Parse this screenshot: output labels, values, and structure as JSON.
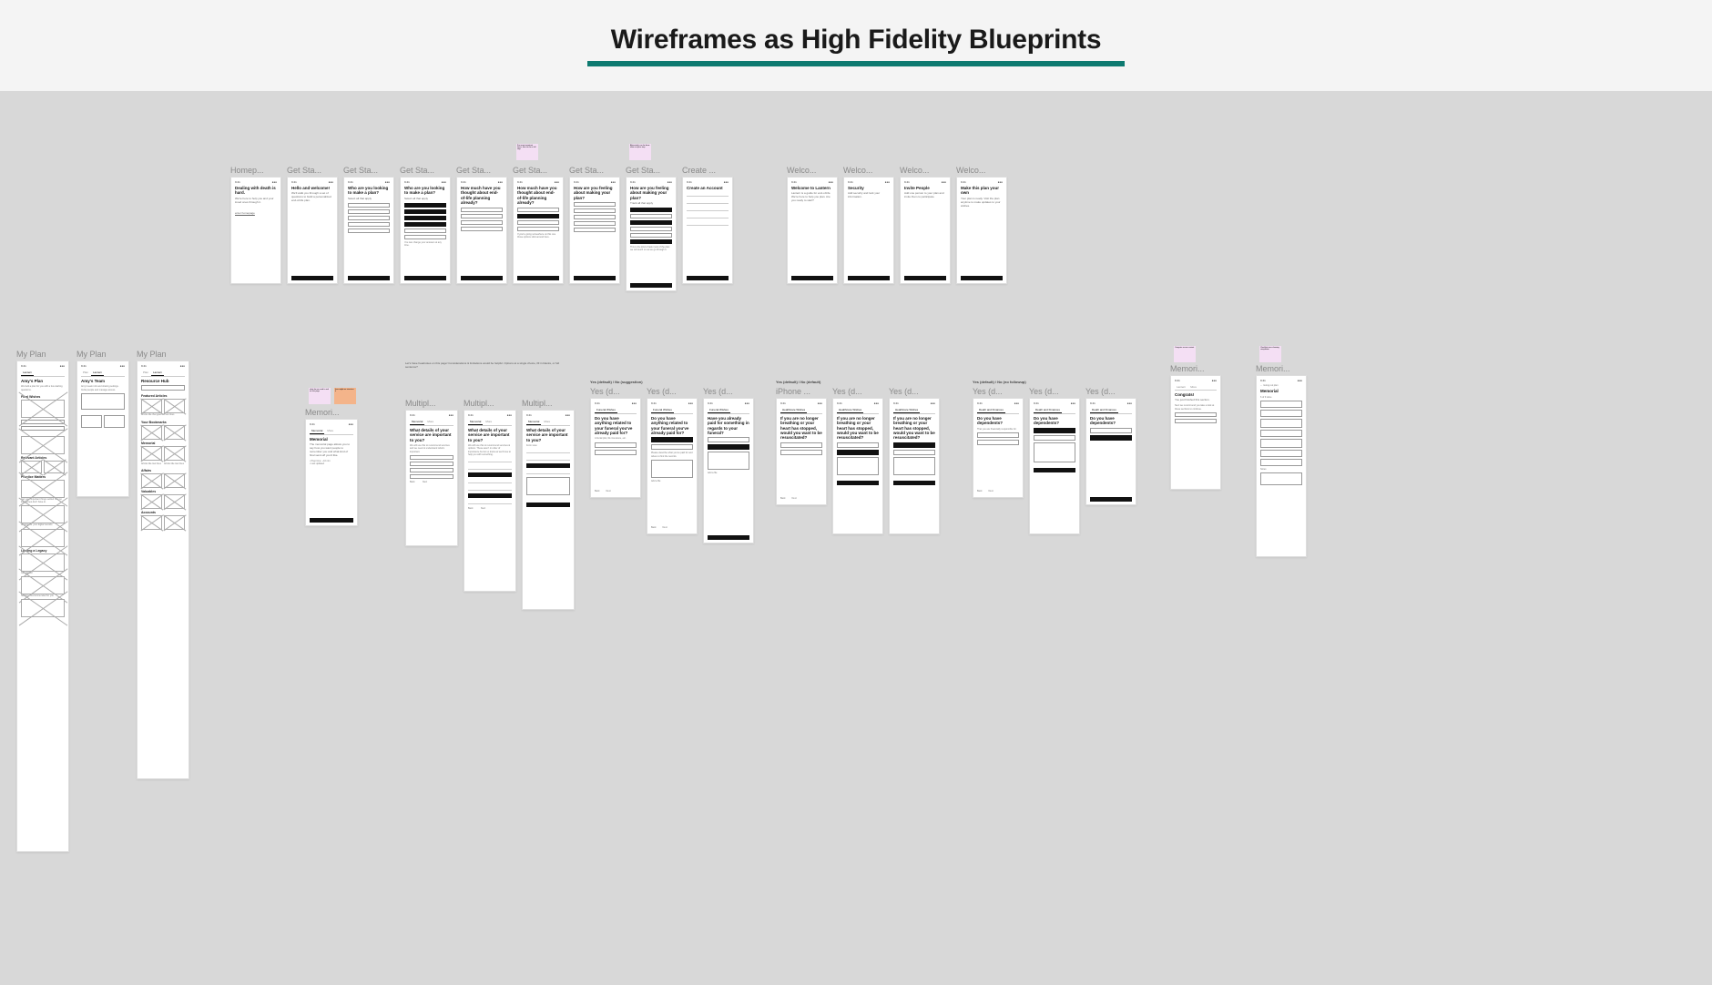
{
  "page_title": "Wireframes as High Fidelity Blueprints",
  "row1": {
    "frames": [
      {
        "label": "Homep...",
        "heading": "Dealing with death is hard.",
        "sub": "We're here to help you and your loved ones through it.",
        "cta": "enter homepage"
      },
      {
        "label": "Get Sta...",
        "heading": "Hello and welcome!",
        "sub": "We'll walk you through a set of questions to build a personalized end-of-life plan."
      },
      {
        "label": "Get Sta...",
        "heading": "Who are you looking to make a plan?",
        "sub": "Select all that apply",
        "options": 5
      },
      {
        "label": "Get Sta...",
        "heading": "Who are you looking to make a plan?",
        "sub": "Select all that apply",
        "options_filled": 6
      },
      {
        "label": "Get Sta...",
        "heading": "How much have you thought about end-of-life planning already?",
        "options": 4
      },
      {
        "label": "Get Sta...",
        "heading": "How much have you thought about end-of-life planning already?",
        "options": 4,
        "sticky": "For more important items, this can be a full step"
      },
      {
        "label": "Get Sta...",
        "heading": "How are you feeling about making your plan?",
        "options": 5
      },
      {
        "label": "Get Sta...",
        "heading": "How are you feeling about making your plan?",
        "sub": "Track all that apply",
        "options": 6,
        "sticky": "Alternately, can be done inline on prior step"
      },
      {
        "label": "Create ...",
        "heading": "Create an Account",
        "inputs": 5
      }
    ]
  },
  "row1b": {
    "frames": [
      {
        "label": "Welco...",
        "heading": "Welcome to Lantern",
        "sub": "Lantern is a guide for end-of-life. We're here to help you plan. Are you ready to start?"
      },
      {
        "label": "Welco...",
        "heading": "Security",
        "sub": "Add security and lock your information."
      },
      {
        "label": "Welco...",
        "heading": "Invite People",
        "sub": "Add one person to your plan and invite them to participate."
      },
      {
        "label": "Welco...",
        "heading": "Make this plan your own",
        "sub": "Your plan is ready. Visit the plan anytime to make updates to your wishes."
      }
    ]
  },
  "myplan": {
    "frames": [
      {
        "label": "My Plan",
        "owner": "Amy's Plan",
        "sections": [
          "Final Wishes",
          "Relevant Articles",
          "Practice Matters",
          "Lasting a Legacy"
        ]
      },
      {
        "label": "My Plan",
        "owner": "Amy's Team"
      },
      {
        "label": "My Plan",
        "owner": "Resource Hub",
        "sections": [
          "Featured Articles",
          "Your Bookmarks",
          "Memorial",
          "Affairs",
          "Valuables",
          "Accounts"
        ]
      }
    ]
  },
  "memorial": {
    "frames": [
      {
        "label": "Memori...",
        "heading": "Memorial",
        "body": "The memorial page allows you to say how you want people to remember you and what kind of final send-off you'd like.",
        "sticky1": "what do we need to ask on this page",
        "sticky2": "how might we structure it"
      },
      {
        "label": "Multipl...",
        "annotation": "Let's have headnotes on this page! Considerations & limitations would be helpful. Options at a single choice, fill in blanks, or full sentence?",
        "heading": "What details of your service are important to you?",
        "options": 4
      },
      {
        "label": "Multipl...",
        "heading": "What details of your service are important to you?",
        "inputs": 6
      },
      {
        "label": "Multipl...",
        "heading": "What details of your service are important to you?",
        "inputs": 5
      }
    ]
  },
  "yesno_a": {
    "group_label": "Yes (default) / No (suggestion)",
    "frames": [
      {
        "label": "Yes (d...",
        "heading": "Do you have anything related to your funeral you've already paid for?",
        "yn": true
      },
      {
        "label": "Yes (d...",
        "heading": "Do you have anything related to your funeral you've already paid for?",
        "yn": true,
        "followup": true
      },
      {
        "label": "Yes (d...",
        "heading": "Have you already paid for something in regards to your funeral?",
        "yn": true,
        "followup": true
      }
    ]
  },
  "yesno_b": {
    "group_label": "Yes (default) / No (default)",
    "frames": [
      {
        "label": "iPhone ...",
        "heading": "If you are no longer breathing or your heart has stopped, would you want to be resuscitated?",
        "yn": true
      },
      {
        "label": "Yes (d...",
        "heading": "If you are no longer breathing or your heart has stopped, would you want to be resuscitated?",
        "yn": true,
        "followup": true
      },
      {
        "label": "Yes (d...",
        "heading": "If you are no longer breathing or your heart has stopped, would you want to be resuscitated?",
        "yn": true,
        "followup": true
      }
    ]
  },
  "yesno_c": {
    "group_label": "Yes (default) / No (no followup)",
    "frames": [
      {
        "label": "Yes (d...",
        "heading": "Do you have dependents?",
        "yn": true
      },
      {
        "label": "Yes (d...",
        "heading": "Do you have dependents?",
        "yn": true,
        "followup": true
      },
      {
        "label": "Yes (d...",
        "heading": "Do you have dependents?",
        "yn": true
      }
    ]
  },
  "memorial2": {
    "frames": [
      {
        "label": "Memori...",
        "heading": "Congrats!",
        "sub": "You just finished this section.",
        "sticky": "Congrats screen variant"
      },
      {
        "label": "Memori...",
        "heading": "Memorial",
        "sticky": "Checklist view showing completion"
      }
    ]
  }
}
